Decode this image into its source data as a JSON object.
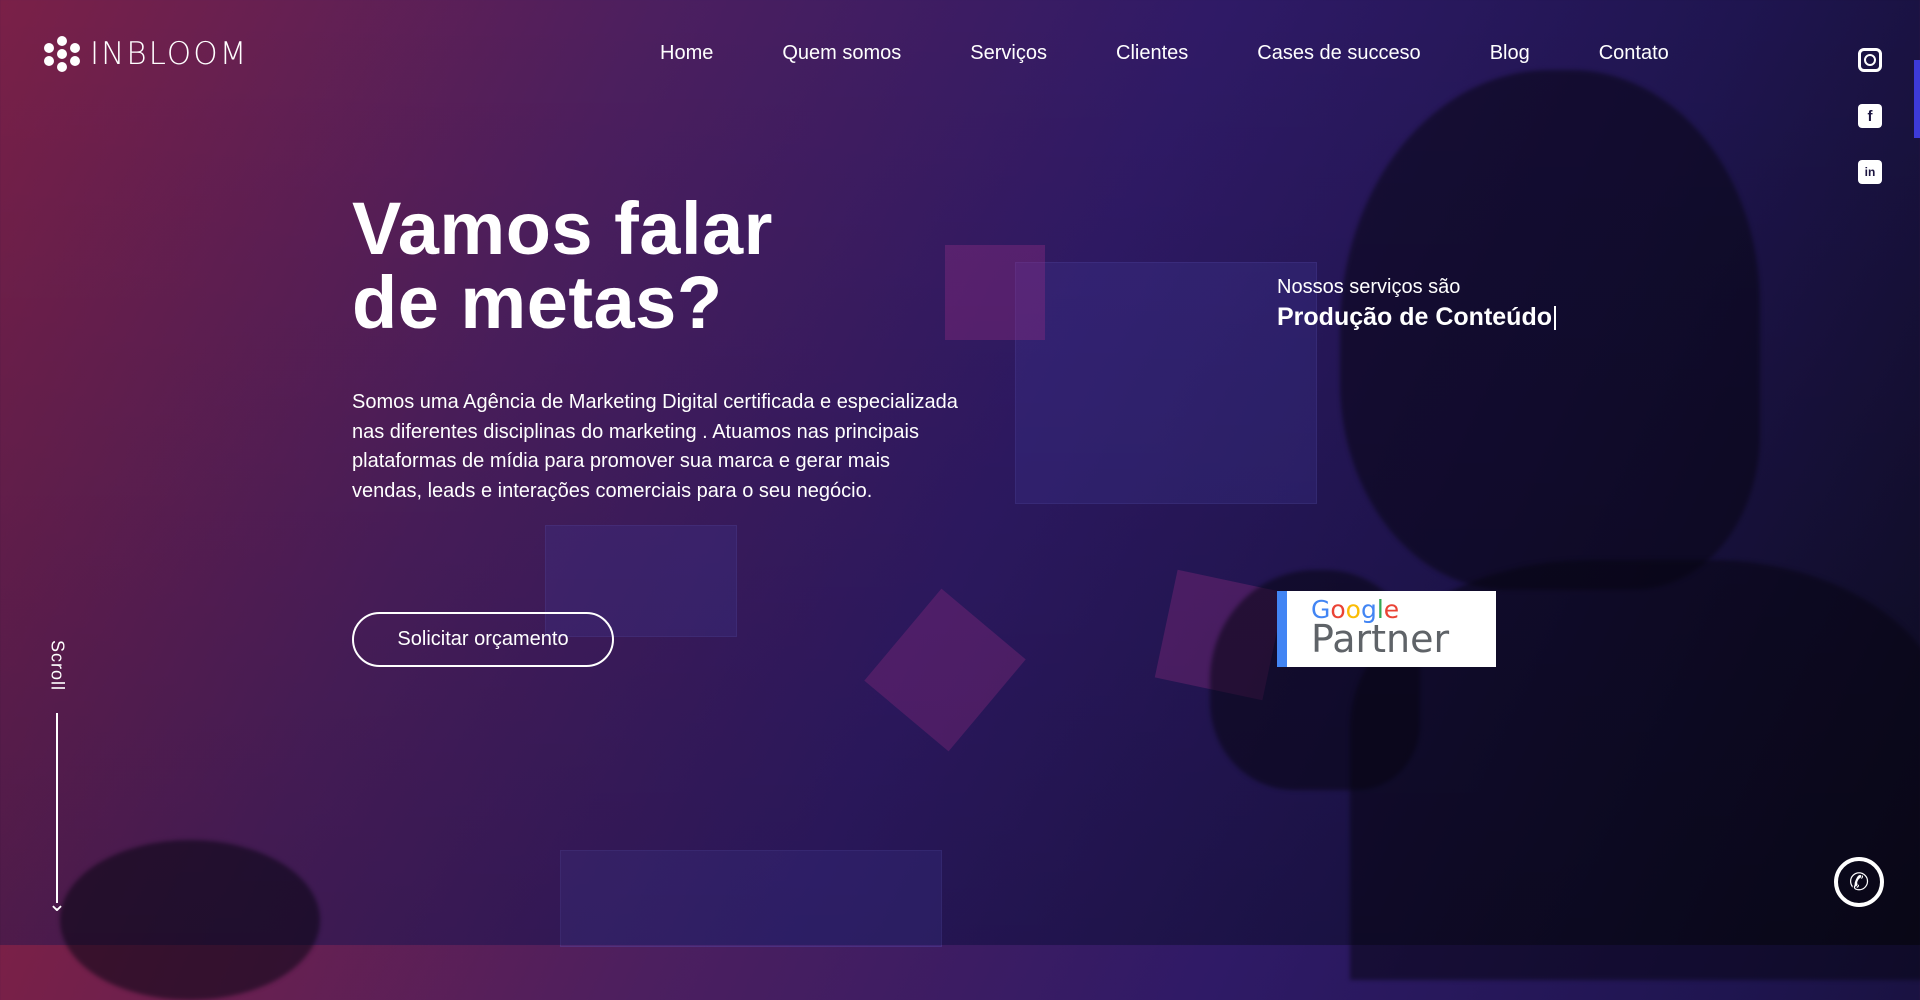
{
  "brand": {
    "name": "INBLOOM"
  },
  "nav": {
    "items": [
      {
        "label": "Home"
      },
      {
        "label": "Quem somos"
      },
      {
        "label": "Serviços"
      },
      {
        "label": "Clientes"
      },
      {
        "label": "Cases de succeso"
      },
      {
        "label": "Blog"
      },
      {
        "label": "Contato"
      }
    ]
  },
  "social": {
    "icons": [
      "instagram-icon",
      "facebook-icon",
      "linkedin-icon"
    ]
  },
  "hero": {
    "title_line1": "Vamos falar",
    "title_line2": "de metas?",
    "description": "Somos uma Agência de Marketing Digital certificada e especializada nas diferentes disciplinas do marketing . Atuamos nas principais plataformas de mídia para promover sua marca e gerar mais vendas, leads e interações comerciais para o seu negócio.",
    "cta_label": "Solicitar orçamento"
  },
  "services": {
    "label": "Nossos serviços são",
    "current": "Produção de Conteúdo"
  },
  "badge": {
    "google": "Google",
    "partner": "Partner"
  },
  "scroll": {
    "label": "Scroll"
  },
  "colors": {
    "accent": "#3d3ad8",
    "google_blue": "#4285f4"
  }
}
